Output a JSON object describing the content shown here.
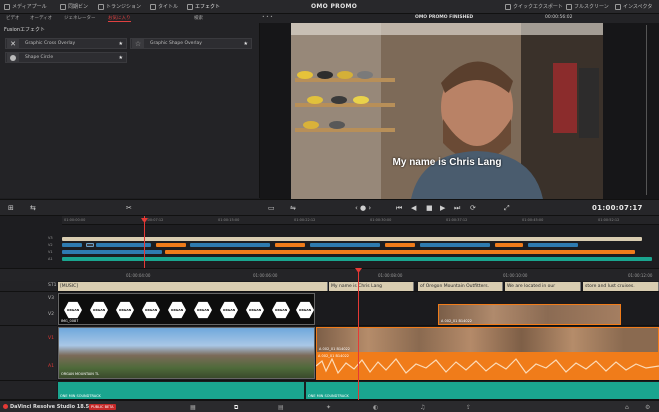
{
  "toolbar": {
    "items": [
      "メディアプール",
      "同期ビン",
      "トランジション",
      "タイトル",
      "エフェクト"
    ],
    "project_title": "OMO PROMO",
    "right_items": [
      "クイックエクスポート",
      "フルスクリーン",
      "インスペクタ"
    ]
  },
  "effects": {
    "tabs": [
      "ビデオ",
      "オーディオ",
      "ジェネレーター",
      "お気に入り"
    ],
    "selected_tab": "お気に入り",
    "search_tab": "検索",
    "header": "Fusionエフェクト",
    "items": [
      {
        "label": "Graphic Cross Overlay"
      },
      {
        "label": "Graphic Shape Overlay"
      },
      {
        "label": "Shape Circle"
      }
    ]
  },
  "viewer": {
    "timeline_name": "OMO PROMO FINISHED",
    "duration": "00:00:56:02",
    "subtitle": "My name is Chris Lang"
  },
  "transport": {
    "timecode": "01:00:07:17"
  },
  "mini_timeline": {
    "ruler_ticks": [
      "01:00:00:00",
      "01:00:07:12",
      "01:00:15:00",
      "01:00:22:12",
      "01:00:30:00",
      "01:00:37:12",
      "01:00:45:00",
      "01:00:52:12"
    ],
    "tracks": [
      "V3",
      "V2",
      "V1",
      "A1"
    ]
  },
  "timeline": {
    "ruler_ticks": [
      "01:00:04:00",
      "01:00:06:00",
      "01:00:08:00",
      "01:00:10:00",
      "01:00:12:00"
    ],
    "tracks": {
      "st1": "ST1",
      "v3": "V3",
      "v2": "V2",
      "v1": "V1",
      "a1": "A1"
    },
    "subtitles": [
      "[MUSIC]",
      "My name is Chris Lang",
      "of Oregon Mountain Outfitters.",
      "We are located in our",
      "store and lust cruises."
    ],
    "clips": {
      "logo_label": "ORGAN",
      "logo_clip": "IMG_0087",
      "landscape": "ORGAN MOUNTAIN TL",
      "interview_v2": "A 002_01 B14022",
      "interview_v1": "A 002_01 B14022",
      "interview_a1": "A 002_01 B14022",
      "music": "ONE MIN SOUNDTRACK",
      "music2": "ONE MIN SOUNDTRACK"
    }
  },
  "bottombar": {
    "brand": "DaVinci Resolve Studio 18.5",
    "beta": "PUBLIC BETA"
  },
  "colors": {
    "accent": "#e53935",
    "orange_clip": "#f07c1a",
    "blue_clip": "#2e7bb0",
    "teal_clip": "#1aa58f",
    "subtitle_clip": "#d9cdb1"
  }
}
